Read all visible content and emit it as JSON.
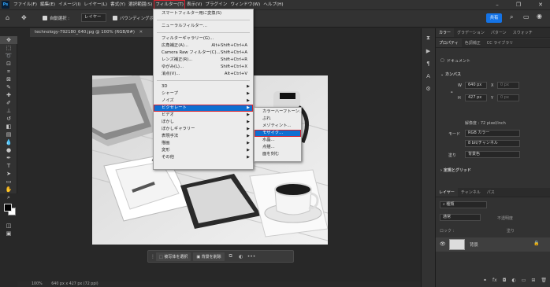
{
  "app_icon": "Ps",
  "menubar": {
    "items": [
      "ファイル(F)",
      "編集(E)",
      "イメージ(I)",
      "レイヤー(L)",
      "書式(Y)",
      "選択範囲(S)",
      "フィルター(T)",
      "表示(V)",
      "プラグイン",
      "ウィンドウ(W)",
      "ヘルプ(H)"
    ],
    "active_index": 6
  },
  "options_bar": {
    "auto_select_label": "自動選択 :",
    "auto_select_value": "レイヤー",
    "transform_label": "バウンディングボ",
    "share_button": "共有"
  },
  "document_tab": {
    "title": "technology-792180_640.jpg @ 100% (RGB/8#)"
  },
  "status_bar": {
    "zoom": "100%",
    "size": "640 px x 427 px (72 ppi)"
  },
  "contextual_bar": {
    "select_subject": "被写体を選択",
    "remove_bg": "背景を削除"
  },
  "filter_menu": {
    "top_items": [
      {
        "label": "スマートフィルター用に変換(S)",
        "shortcut": ""
      },
      {
        "label": "ニューラルフィルター...",
        "shortcut": ""
      },
      {
        "label": "フィルターギャラリー(G)...",
        "shortcut": ""
      },
      {
        "label": "広角補正(A)...",
        "shortcut": "Alt+Shift+Ctrl+A"
      },
      {
        "label": "Camera Raw フィルター(C)...",
        "shortcut": "Shift+Ctrl+A"
      },
      {
        "label": "レンズ補正(R)...",
        "shortcut": "Shift+Ctrl+R"
      },
      {
        "label": "ゆがみ(L)...",
        "shortcut": "Shift+Ctrl+X"
      },
      {
        "label": "消点(V)...",
        "shortcut": "Alt+Ctrl+V"
      }
    ],
    "sub_items": [
      "3D",
      "シャープ",
      "ノイズ",
      "ピクセレート",
      "ビデオ",
      "ぼかし",
      "ぼかしギャラリー",
      "表現手法",
      "描画",
      "変形",
      "その他"
    ],
    "highlighted": "ピクセレート"
  },
  "pixelate_submenu": {
    "items": [
      "カラーハーフトーン...",
      "ぶれ",
      "メゾティント...",
      "モザイク...",
      "水晶...",
      "点描...",
      "面を刻む"
    ],
    "highlighted": "モザイク..."
  },
  "right_panel": {
    "top_tabs": [
      "カラー",
      "グラデーション",
      "パターン",
      "スウォッチ"
    ],
    "prop_tabs": [
      "プロパティ",
      "色調補正",
      "CC ライブラリ"
    ],
    "doc_label": "ドキュメント",
    "canvas_header": "カンバス",
    "w_label": "W",
    "w_value": "640 px",
    "x_label": "X",
    "x_placeholder": "0 px",
    "h_label": "H",
    "h_value": "427 px",
    "y_label": "Y",
    "y_placeholder": "0 px",
    "resolution": "解像度 : 72 pixel/inch",
    "mode_label": "モード",
    "mode_value": "RGB カラー",
    "bit_value": "8 bit/チャンネル",
    "fill_label": "塗り",
    "fill_value": "背景色",
    "ruler_header": "定規とグリッド",
    "layer_tabs": [
      "レイヤー",
      "チャンネル",
      "パス"
    ],
    "search_placeholder": "種類",
    "blend_mode": "通常",
    "opacity_label": "不透明度",
    "lock_label": "ロック :",
    "fill2_label": "塗り",
    "layer_name": "背景"
  }
}
